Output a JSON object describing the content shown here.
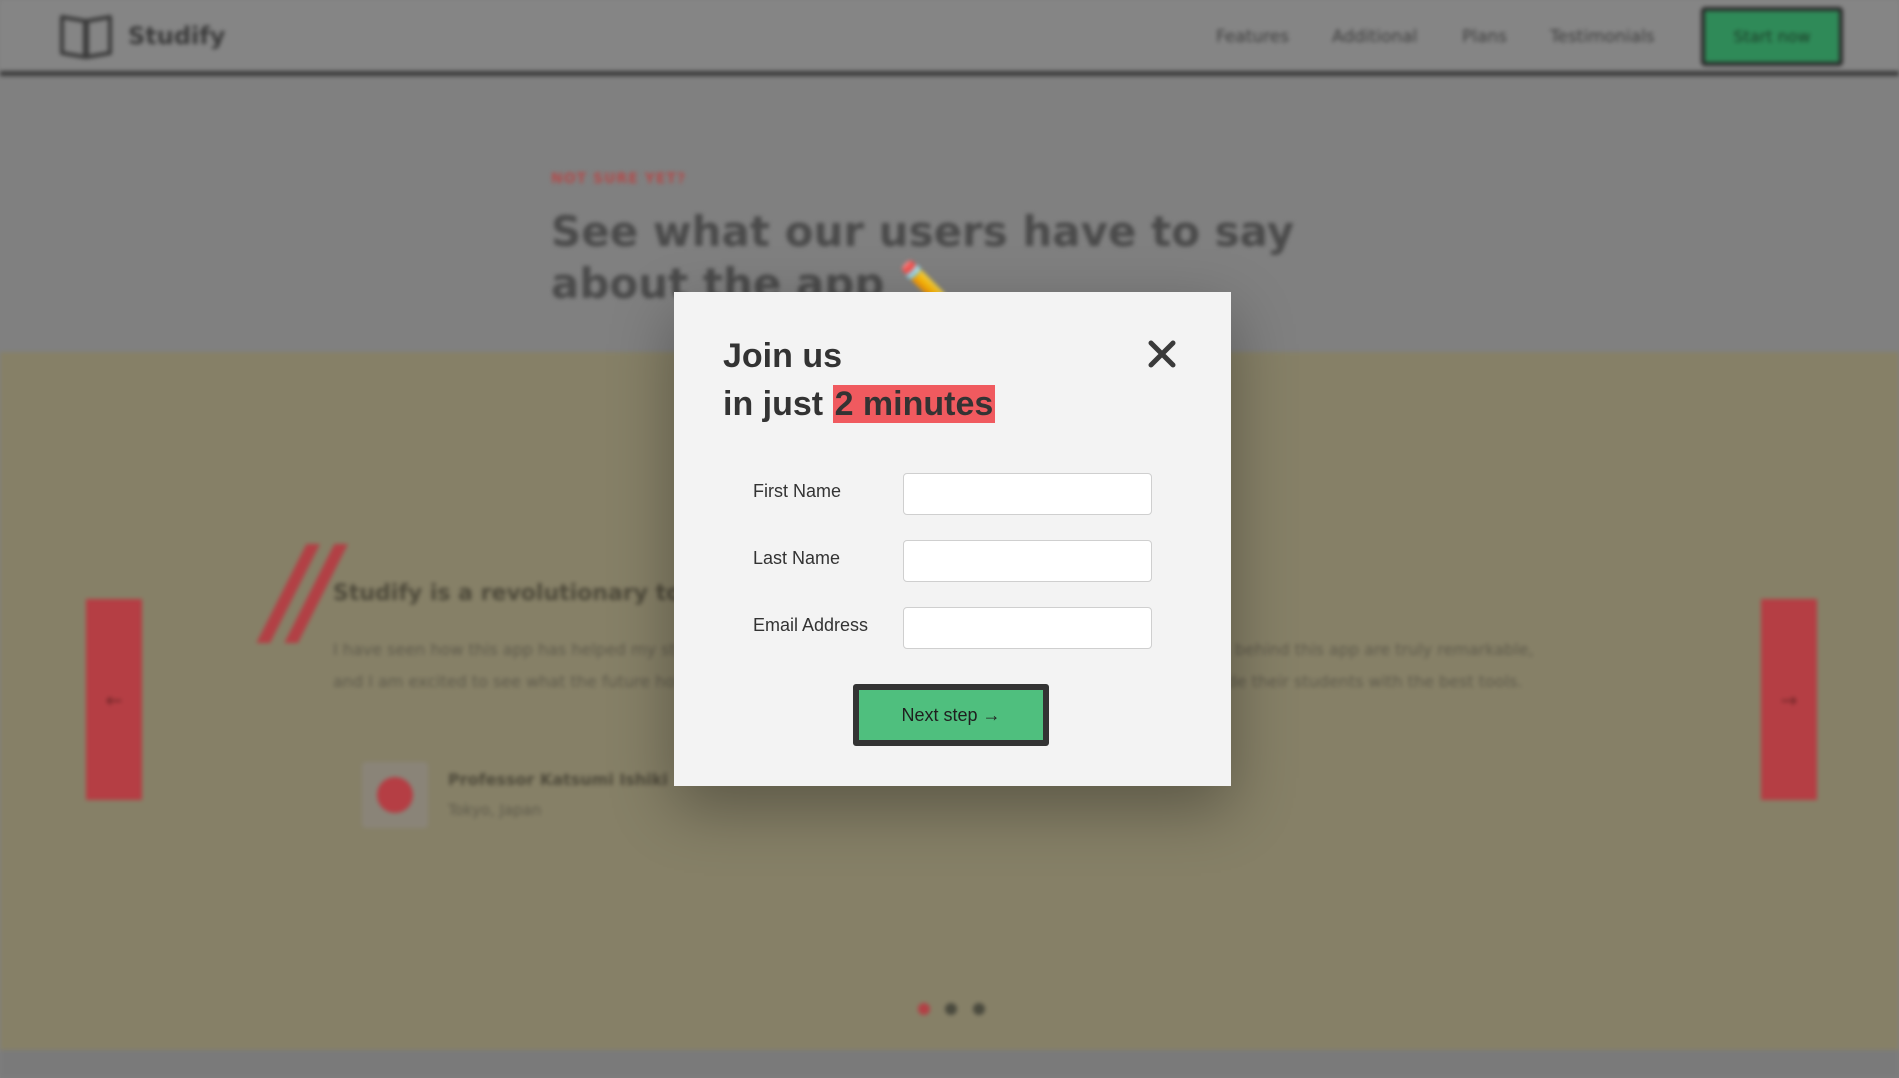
{
  "nav": {
    "brand": "Studify",
    "links": [
      "Features",
      "Additional",
      "Plans",
      "Testimonials"
    ],
    "cta": "Start now"
  },
  "hero": {
    "kicker": "NOT SURE YET?",
    "headline": "See what our users have to say about the app ✏️"
  },
  "testimonial": {
    "prev": "←",
    "next": "→",
    "title": "Studify is a revolutionary tool!",
    "text": "I have seen how this app has helped my students improve their grades and make progress. The AI technologies behind this app are truly remarkable, and I am excited to see what the future holds. I highly recommend this app to any educator who wants to provide their students with the best tools.",
    "author_name": "Professor Katsumi Ishiki",
    "author_location": "Tokyo, Japan",
    "active_dot": 1,
    "dot_count": 3
  },
  "modal": {
    "title_line1": "Join us",
    "title_line2_prefix": "in just ",
    "title_highlight": "2 minutes",
    "fields": [
      {
        "label": "First Name",
        "value": ""
      },
      {
        "label": "Last Name",
        "value": ""
      },
      {
        "label": "Email Address",
        "value": ""
      }
    ],
    "submit": "Next step →"
  },
  "colors": {
    "accent_red": "#f05a5f",
    "accent_green": "#4fbf7e",
    "modal_bg": "#f3f3f3"
  }
}
